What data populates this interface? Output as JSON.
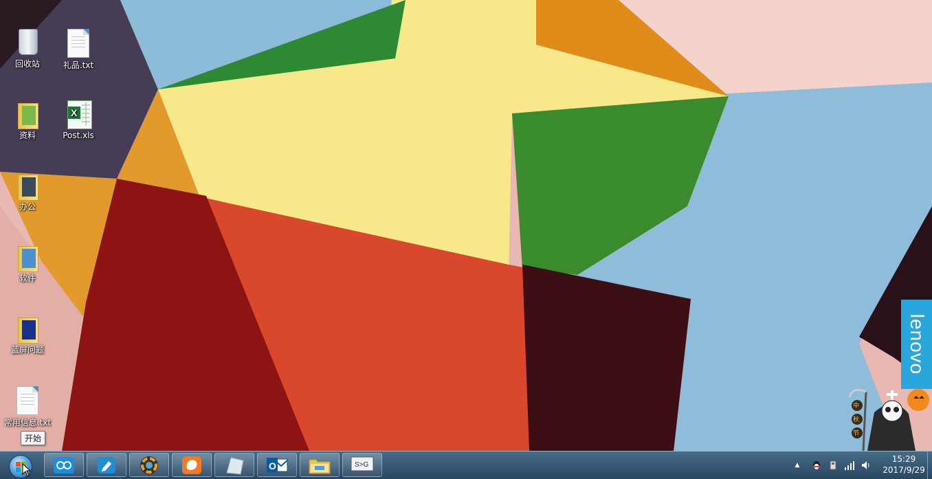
{
  "desktop": {
    "icons": [
      {
        "label": "回收站",
        "type": "recycle-bin"
      },
      {
        "label": "礼品.txt",
        "type": "text-file"
      },
      {
        "label": "资料",
        "type": "folder"
      },
      {
        "label": "Post.xls",
        "type": "excel-file"
      },
      {
        "label": "办公",
        "type": "folder"
      },
      {
        "label": "软件",
        "type": "folder"
      },
      {
        "label": "蓝屏问题",
        "type": "folder"
      },
      {
        "label": "常用信息.txt",
        "type": "text-file"
      }
    ],
    "brand_badge": "lenovo",
    "mascot_chars": [
      "中",
      "秋",
      "节"
    ]
  },
  "start_tooltip": "开始",
  "taskbar": {
    "pinned": [
      {
        "name": "baidu-netdisk",
        "icon": "cloud-icon"
      },
      {
        "name": "sticky-notes",
        "icon": "pencil-icon"
      },
      {
        "name": "color-app",
        "icon": "color-wheel-icon"
      },
      {
        "name": "uc-browser",
        "icon": "squirrel-icon"
      },
      {
        "name": "glass-app",
        "icon": "glass-icon"
      },
      {
        "name": "outlook",
        "icon": "outlook-icon",
        "text": "O"
      },
      {
        "name": "file-explorer",
        "icon": "folder-icon"
      },
      {
        "name": "remote-desktop",
        "icon": "monitor-icon",
        "text": "S>G"
      }
    ],
    "tray": {
      "chevron": "▲",
      "time": "15:29",
      "date": "2017/9/29"
    }
  },
  "colors": {
    "lenovo": "#29a6dc",
    "taskbar": "#2d587a"
  }
}
